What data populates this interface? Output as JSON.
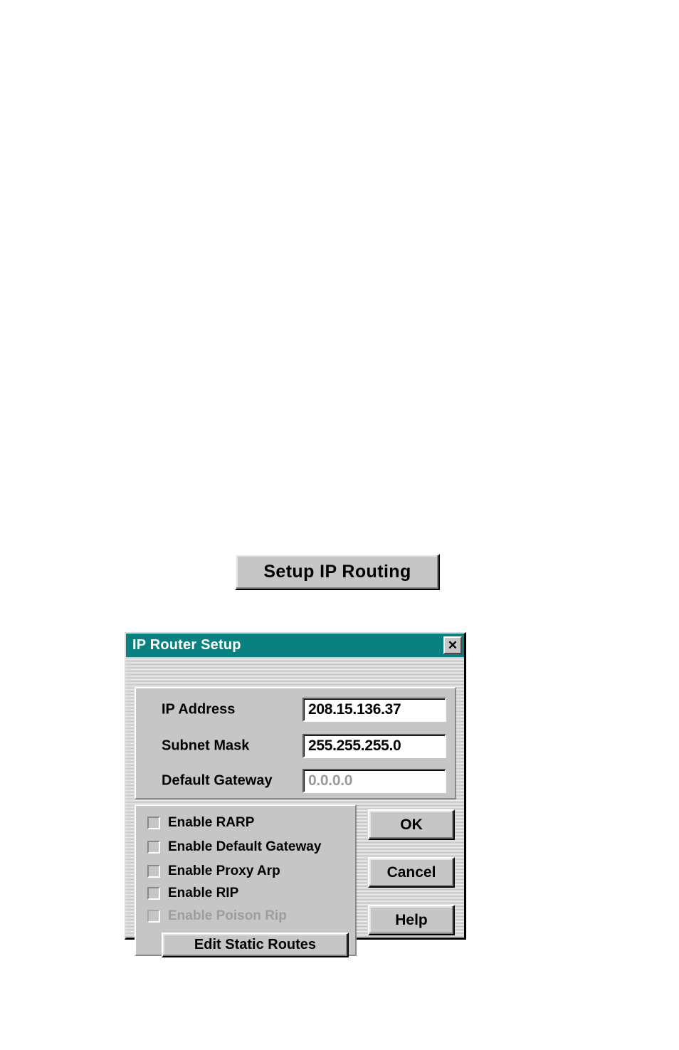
{
  "page": {
    "background_color": "#ffffff"
  },
  "setup_button": {
    "label": "Setup IP Routing"
  },
  "dialog": {
    "title": "IP Router Setup",
    "titlebar_color": "#0a8080",
    "face_color": "#c6c6c6",
    "close_button": {
      "icon": "close-x-icon",
      "glyph": "✕"
    },
    "fields": [
      {
        "label": "IP Address",
        "value": "208.15.136.37",
        "disabled": false
      },
      {
        "label": "Subnet Mask",
        "value": "255.255.255.0",
        "disabled": false
      },
      {
        "label": "Default Gateway",
        "value": "0.0.0.0",
        "disabled": true
      }
    ],
    "checkboxes": [
      {
        "label": "Enable RARP",
        "checked": false,
        "disabled": false
      },
      {
        "label": "Enable Default Gateway",
        "checked": false,
        "disabled": false
      },
      {
        "label": "Enable Proxy Arp",
        "checked": false,
        "disabled": false
      },
      {
        "label": "Enable RIP",
        "checked": false,
        "disabled": false
      },
      {
        "label": "Enable Poison Rip",
        "checked": false,
        "disabled": true
      }
    ],
    "edit_routes_button": {
      "label": "Edit Static Routes"
    },
    "buttons": {
      "ok": "OK",
      "cancel": "Cancel",
      "help": "Help"
    }
  }
}
